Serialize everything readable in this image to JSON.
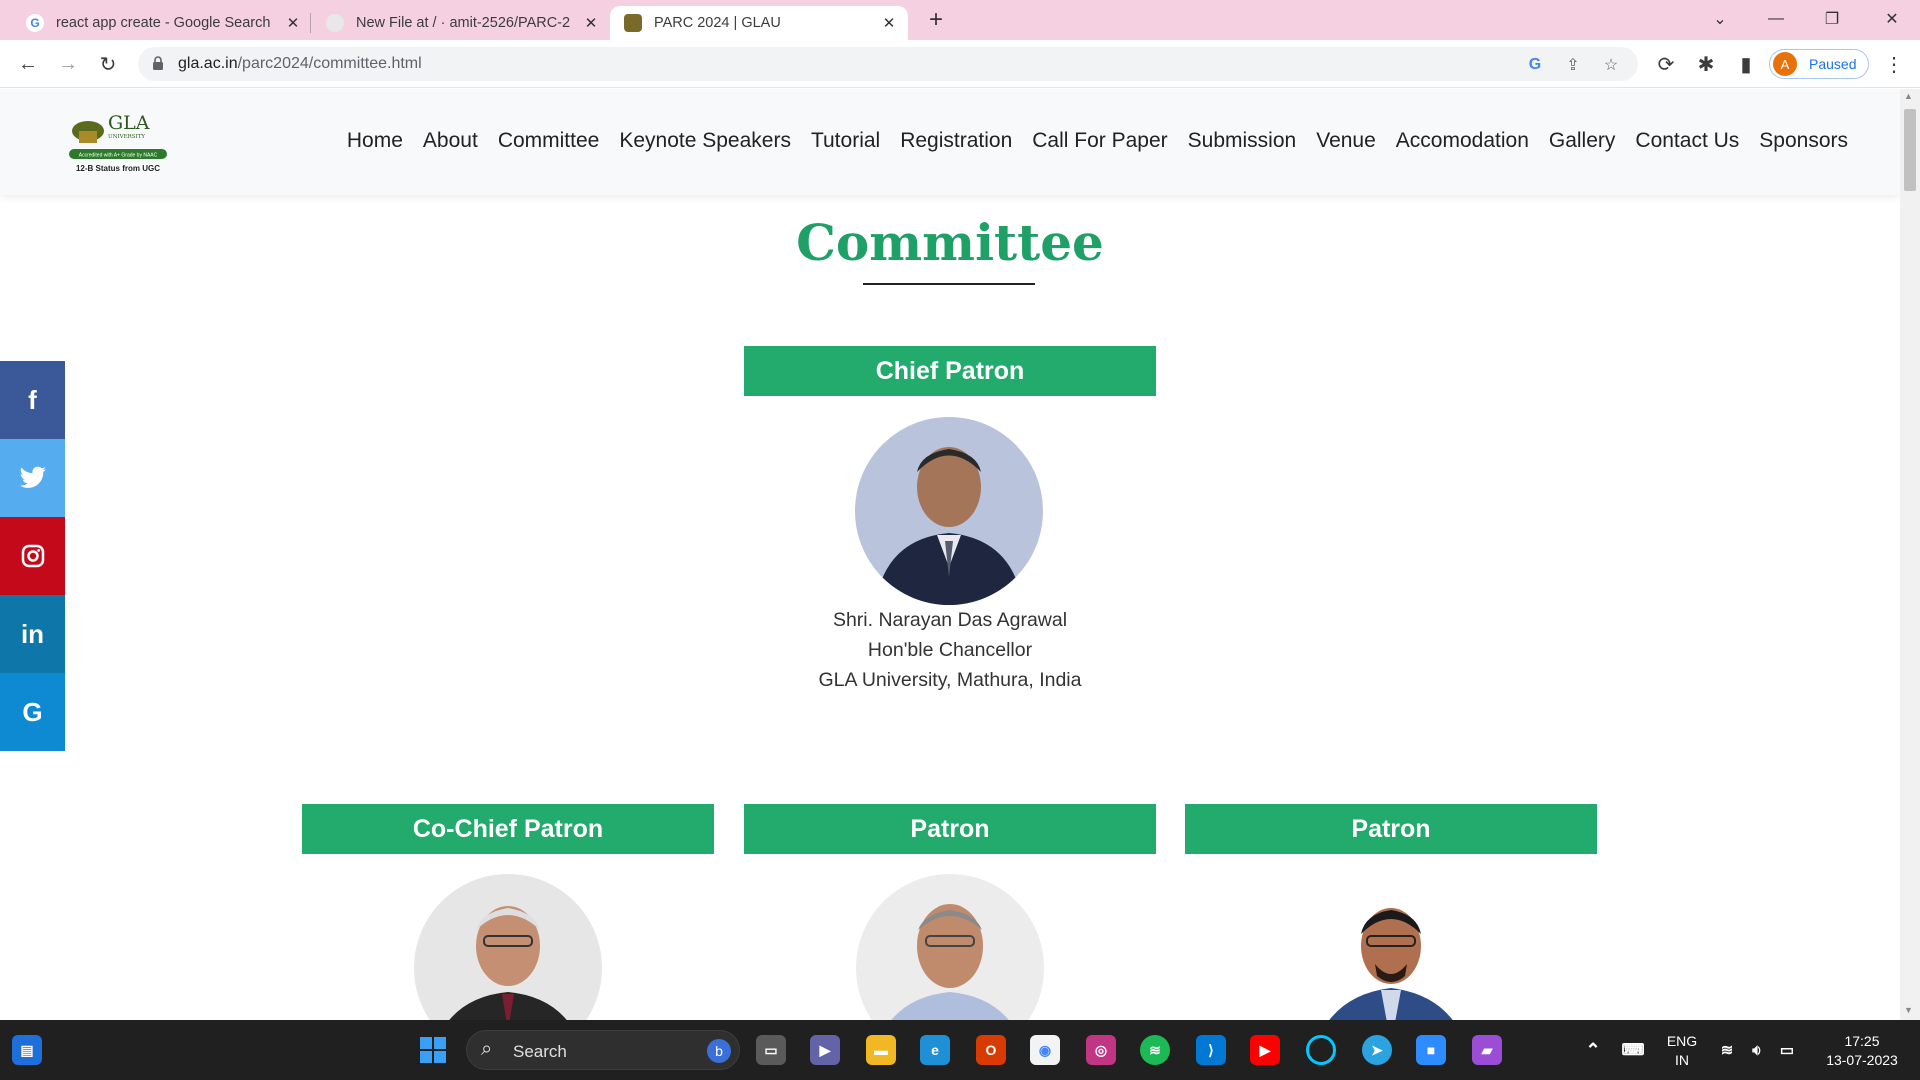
{
  "browser": {
    "tabs": [
      {
        "title": "react app create - Google Search",
        "active": false
      },
      {
        "title": "New File at / · amit-2526/PARC-2",
        "active": false
      },
      {
        "title": "PARC 2024 | GLAU",
        "active": true
      }
    ],
    "url_domain": "gla.ac.in",
    "url_path": "/parc2024/committee.html",
    "profile_initial": "A",
    "profile_status": "Paused"
  },
  "site": {
    "logo": {
      "name": "GLA",
      "sub": "UNIVERSITY",
      "accreditation": "Accredited with A+ Grade by NAAC",
      "status": "12-B Status from UGC"
    },
    "nav": [
      "Home",
      "About",
      "Committee",
      "Keynote Speakers",
      "Tutorial",
      "Registration",
      "Call For Paper",
      "Submission",
      "Venue",
      "Accomodation",
      "Gallery",
      "Contact Us",
      "Sponsors"
    ]
  },
  "page": {
    "title": "Committee",
    "chief_patron": {
      "role": "Chief Patron",
      "name": "Shri. Narayan Das Agrawal",
      "designation": "Hon'ble Chancellor",
      "affiliation": "GLA University, Mathura, India"
    },
    "second_row": [
      {
        "role": "Co-Chief Patron"
      },
      {
        "role": "Patron"
      },
      {
        "role": "Patron"
      }
    ]
  },
  "social": [
    "facebook",
    "twitter",
    "instagram",
    "linkedin",
    "google"
  ],
  "taskbar": {
    "search_label": "Search",
    "lang_1": "ENG",
    "lang_2": "IN",
    "time": "17:25",
    "date": "13-07-2023"
  },
  "colors": {
    "accent_green": "#22ab6c",
    "tab_strip": "#f5d0e0",
    "facebook": "#3b5998",
    "twitter": "#55acee",
    "instagram": "#c4091a",
    "linkedin": "#0e76a8",
    "google": "#0d8ad1"
  }
}
